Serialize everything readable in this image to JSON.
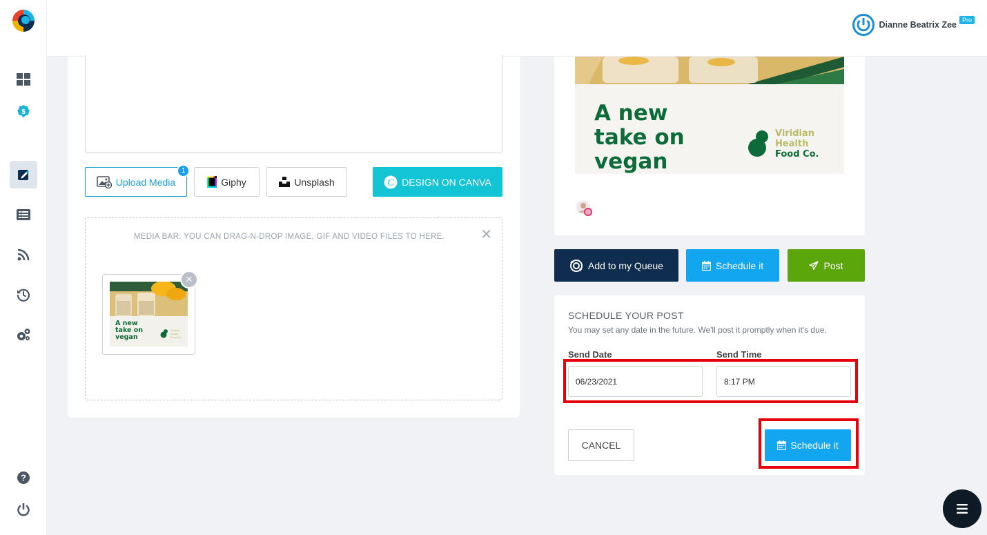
{
  "header": {
    "user_name": "Dianne Beatrix Zee",
    "badge": "Pro"
  },
  "sidebar": {
    "items": [
      {
        "icon": "dashboard-icon"
      },
      {
        "icon": "billing-icon"
      },
      {
        "icon": "compose-icon",
        "active": true
      },
      {
        "icon": "queue-list-icon"
      },
      {
        "icon": "rss-feed-icon"
      },
      {
        "icon": "history-icon"
      },
      {
        "icon": "settings-icon"
      },
      {
        "icon": "help-icon"
      },
      {
        "icon": "logout-icon"
      }
    ]
  },
  "composer": {
    "upload_label": "Upload Media",
    "upload_count": "1",
    "giphy_label": "Giphy",
    "unsplash_label": "Unsplash",
    "canva_label": "DESIGN ON CANVA",
    "media_hint": "MEDIA BAR: YOU CAN DRAG-N-DROP IMAGE, GIF AND VIDEO FILES TO HERE.",
    "media_close": "✕",
    "thumb_remove": "×"
  },
  "preview": {
    "headline_line1": "A new",
    "headline_line2": "take on",
    "headline_line3": "vegan",
    "brand_line1": "Viridian",
    "brand_line2": "Health",
    "brand_line3": "Food Co."
  },
  "actions": {
    "queue_label": "Add to my Queue",
    "schedule_label": "Schedule it",
    "post_label": "Post"
  },
  "schedule": {
    "title": "SCHEDULE YOUR POST",
    "description": "You may set any date in the future. We'll post it promptly when it's due.",
    "date_label": "Send Date",
    "date_value": "06/23/2021",
    "time_label": "Send Time",
    "time_value": "8:17 PM",
    "cancel_label": "CANCEL",
    "submit_label": "Schedule it"
  },
  "colors": {
    "accent": "#12a6f1",
    "navy": "#0f2d4e",
    "green": "#5ba60b",
    "canva": "#13c4d4",
    "highlight": "#e8000b",
    "brand_green": "#0d6b3a"
  }
}
